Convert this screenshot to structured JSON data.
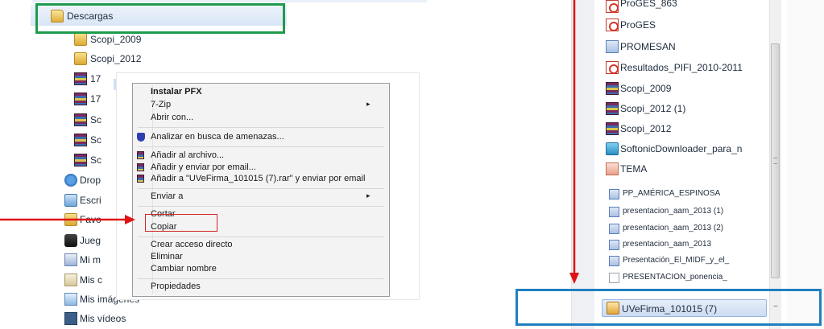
{
  "left_tree": {
    "items": [
      {
        "label": "Descargas"
      },
      {
        "label": "Scopi_2009"
      },
      {
        "label": "Scopi_2012"
      },
      {
        "label": "17"
      },
      {
        "label": "17"
      },
      {
        "label": "Sc"
      },
      {
        "label": "Sc"
      },
      {
        "label": "Sc"
      },
      {
        "label": "Drop"
      },
      {
        "label": "Escri"
      },
      {
        "label": "Favo"
      },
      {
        "label": "Jueg"
      },
      {
        "label": "Mi m"
      },
      {
        "label": "Mis c"
      },
      {
        "label": "Mis imágenes"
      },
      {
        "label": "Mis vídeos"
      }
    ]
  },
  "context_menu": {
    "items": [
      {
        "label": "Instalar PFX",
        "bold": true
      },
      {
        "label": "7-Zip",
        "submenu": true
      },
      {
        "label": "Abrir con..."
      },
      {
        "label": "Analizar en busca de amenazas...",
        "icon": "shield-icon"
      },
      {
        "label": "Añadir al archivo...",
        "icon": "rar-icon"
      },
      {
        "label": "Añadir y enviar por email...",
        "icon": "rar-icon"
      },
      {
        "label": "Añadir a \"UVeFirma_101015 (7).rar\" y enviar por email",
        "icon": "rar-icon"
      },
      {
        "label": "Enviar a",
        "submenu": true
      },
      {
        "label": "Cortar"
      },
      {
        "label": "Copiar",
        "highlighted": true
      },
      {
        "label": "Crear acceso directo"
      },
      {
        "label": "Eliminar"
      },
      {
        "label": "Cambiar nombre"
      },
      {
        "label": "Propiedades"
      }
    ]
  },
  "right_list": {
    "items": [
      {
        "label": "ProGES_863",
        "type": "pdf"
      },
      {
        "label": "ProGES",
        "type": "pdf"
      },
      {
        "label": "PROMESAN",
        "type": "doc"
      },
      {
        "label": "Resultados_PIFI_2010-2011",
        "type": "pdf"
      },
      {
        "label": "Scopi_2009",
        "type": "rar"
      },
      {
        "label": "Scopi_2012 (1)",
        "type": "rar"
      },
      {
        "label": "Scopi_2012",
        "type": "rar"
      },
      {
        "label": "SoftonicDownloader_para_n",
        "type": "exe"
      },
      {
        "label": "TEMA",
        "type": "ppt"
      },
      {
        "label": "PP_AMÉRICA_ESPINOSA",
        "type": "doc"
      },
      {
        "label": "presentacion_aam_2013 (1)",
        "type": "doc"
      },
      {
        "label": "presentacion_aam_2013 (2)",
        "type": "doc"
      },
      {
        "label": "presentacion_aam_2013",
        "type": "doc"
      },
      {
        "label": "Presentación_El_MIDF_y_el_",
        "type": "doc"
      },
      {
        "label": "PRESENTACION_ponencia_",
        "type": "blank"
      },
      {
        "label": "UVeFirma_101015 (7)",
        "type": "pfx"
      }
    ]
  },
  "annotations": {
    "green_box_color": "#1f9b4e",
    "red_box_color": "#d62424",
    "arrow_color": "#e01414",
    "blue_box_color": "#1f7fc2"
  }
}
